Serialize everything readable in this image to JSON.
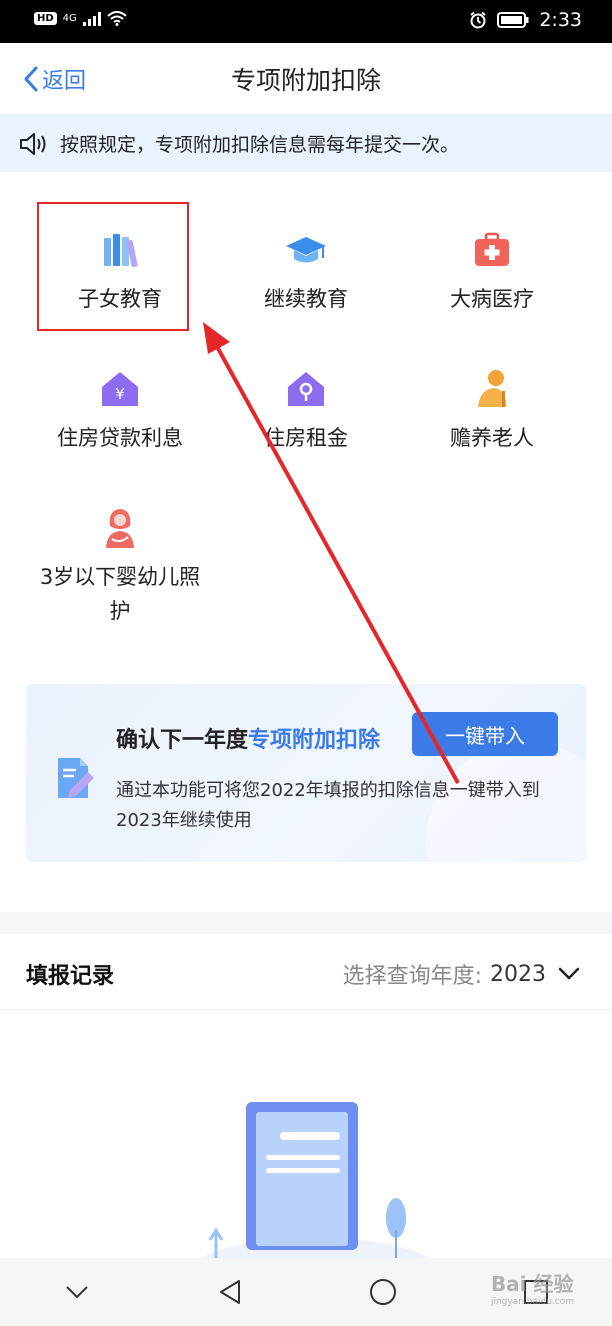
{
  "status_bar": {
    "hd": "HD",
    "network": "4G",
    "time": "2:33"
  },
  "header": {
    "back_label": "返回",
    "title": "专项附加扣除"
  },
  "notice": {
    "text": "按照规定，专项附加扣除信息需每年提交一次。"
  },
  "categories": [
    {
      "label": "子女教育",
      "icon": "books-icon"
    },
    {
      "label": "继续教育",
      "icon": "graduation-cap-icon"
    },
    {
      "label": "大病医疗",
      "icon": "medical-kit-icon"
    },
    {
      "label": "住房贷款利息",
      "icon": "house-yen-icon"
    },
    {
      "label": "住房租金",
      "icon": "house-key-icon"
    },
    {
      "label": "赡养老人",
      "icon": "elderly-person-icon"
    },
    {
      "label": "3岁以下婴幼儿照",
      "label2": "护",
      "icon": "mother-baby-icon"
    }
  ],
  "banner": {
    "title_prefix": "确认下一年度",
    "title_highlight": "专项附加扣除",
    "button_label": "一键带入",
    "description": "通过本功能可将您2022年填报的扣除信息一键带入到2023年继续使用"
  },
  "records": {
    "title": "填报记录",
    "year_label": "选择查询年度:",
    "year_value": "2023"
  },
  "watermark": {
    "text": "Bai 经验",
    "sub": "jingyan.baidu.com"
  },
  "colors": {
    "accent": "#3a7be8",
    "highlight_red": "#e5262b",
    "notice_bg": "#e9f3fd"
  }
}
